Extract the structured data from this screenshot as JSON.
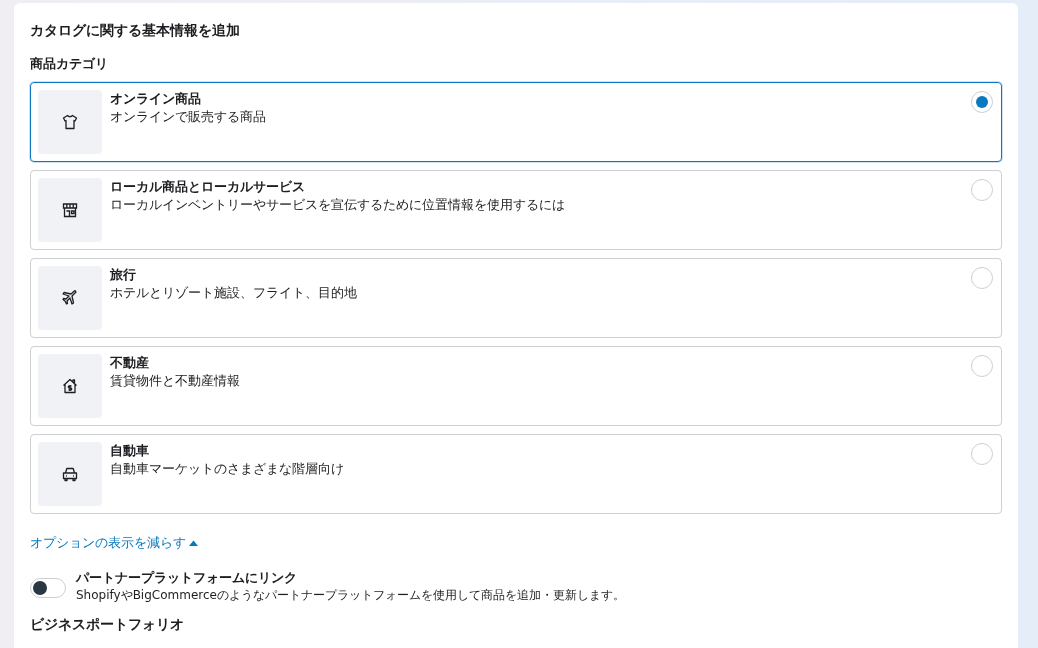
{
  "heading": "カタログに関する基本情報を追加",
  "category_label": "商品カテゴリ",
  "categories": [
    {
      "title": "オンライン商品",
      "description": "オンラインで販売する商品",
      "selected": true
    },
    {
      "title": "ローカル商品とローカルサービス",
      "description": "ローカルインベントリーやサービスを宣伝するために位置情報を使用するには",
      "selected": false
    },
    {
      "title": "旅行",
      "description": "ホテルとリゾート施設、フライト、目的地",
      "selected": false
    },
    {
      "title": "不動産",
      "description": "賃貸物件と不動産情報",
      "selected": false
    },
    {
      "title": "自動車",
      "description": "自動車マーケットのさまざまな階層向け",
      "selected": false
    }
  ],
  "toggle_options_link": "オプションの表示を減らす",
  "partner_link": {
    "title": "パートナープラットフォームにリンク",
    "description": "ShopifyやBigCommerceのようなパートナープラットフォームを使用して商品を追加・更新します。",
    "on": false
  },
  "next_heading": "ビジネスポートフォリオ"
}
